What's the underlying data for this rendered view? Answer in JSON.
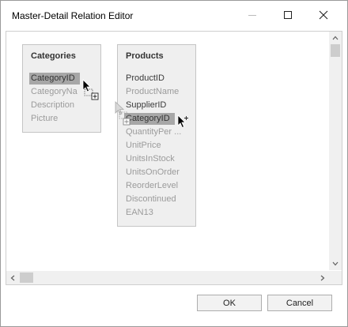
{
  "window": {
    "title": "Master-Detail Relation Editor",
    "controls": [
      "minimize-icon",
      "maximize-icon",
      "close-icon"
    ]
  },
  "tables": [
    {
      "title": "Categories",
      "fields": [
        {
          "label": "CategoryID",
          "selected": true,
          "muted": false
        },
        {
          "label": "CategoryNa",
          "selected": false,
          "muted": true
        },
        {
          "label": "Description",
          "selected": false,
          "muted": true
        },
        {
          "label": "Picture",
          "selected": false,
          "muted": true
        }
      ]
    },
    {
      "title": "Products",
      "fields": [
        {
          "label": "ProductID",
          "selected": false,
          "muted": false
        },
        {
          "label": "ProductName",
          "selected": false,
          "muted": true
        },
        {
          "label": "SupplierID",
          "selected": false,
          "muted": false
        },
        {
          "label": "CategoryID",
          "selected": true,
          "muted": false
        },
        {
          "label": "QuantityPer ...",
          "selected": false,
          "muted": true
        },
        {
          "label": "UnitPrice",
          "selected": false,
          "muted": true
        },
        {
          "label": "UnitsInStock",
          "selected": false,
          "muted": true
        },
        {
          "label": "UnitsOnOrder",
          "selected": false,
          "muted": true
        },
        {
          "label": "ReorderLevel",
          "selected": false,
          "muted": true
        },
        {
          "label": "Discontinued",
          "selected": false,
          "muted": true
        },
        {
          "label": "EAN13",
          "selected": false,
          "muted": true
        }
      ]
    }
  ],
  "buttons": {
    "ok": "OK",
    "cancel": "Cancel"
  }
}
